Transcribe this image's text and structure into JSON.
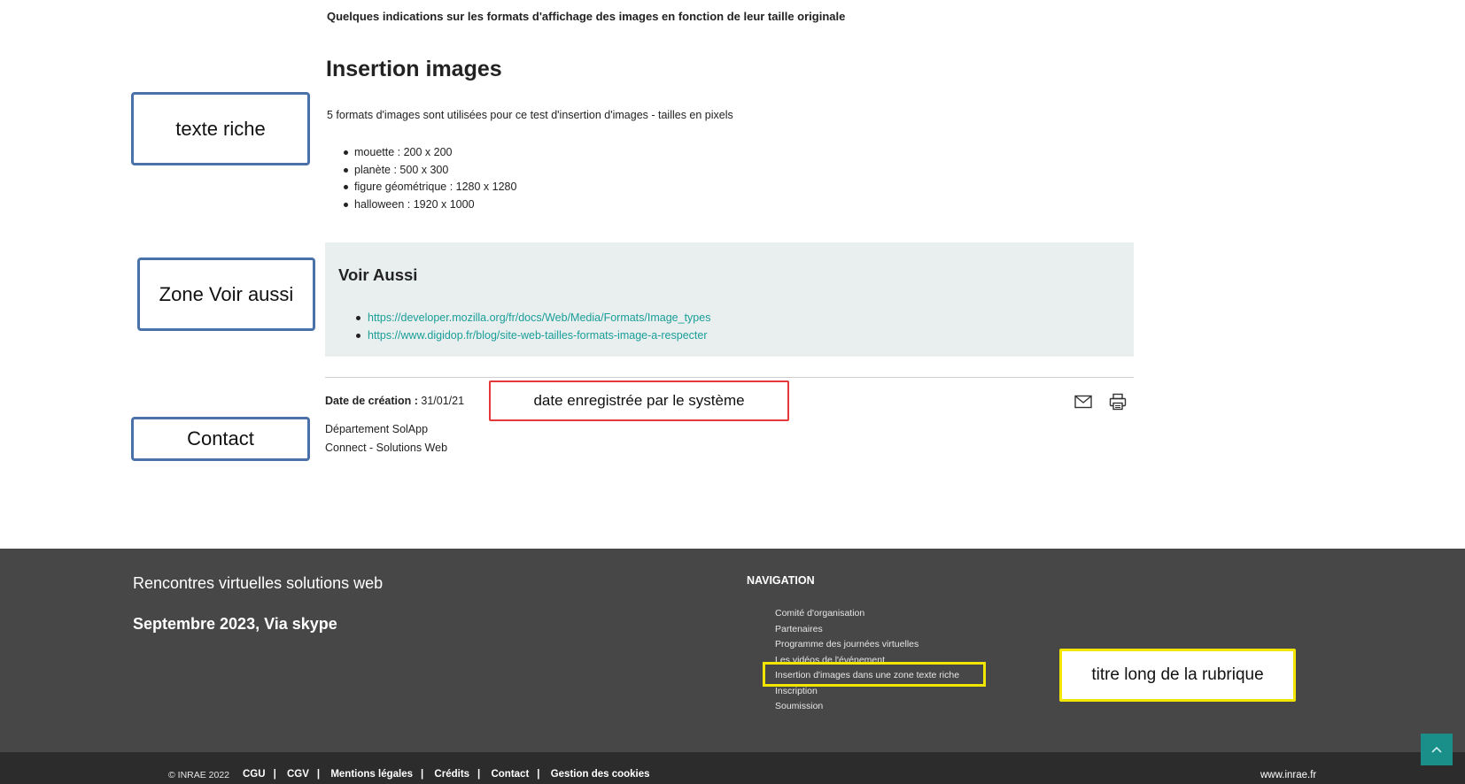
{
  "content": {
    "subtitle": "Quelques indications sur les formats d'affichage des images en fonction de leur taille originale",
    "title": "Insertion images",
    "intro": "5 formats d'images sont utilisées pour ce test d'insertion d'images - tailles en pixels",
    "formats": [
      "mouette : 200 x 200",
      "planète : 500 x 300",
      "figure géométrique : 1280 x 1280",
      "halloween : 1920 x 1000"
    ]
  },
  "voir_aussi": {
    "title": "Voir Aussi",
    "links": [
      "https://developer.mozilla.org/fr/docs/Web/Media/Formats/Image_types",
      "https://www.digidop.fr/blog/site-web-tailles-formats-image-a-respecter"
    ]
  },
  "meta": {
    "date_label": "Date de création :",
    "date_value": "31/01/21",
    "contact_line1": "Département SolApp",
    "contact_line2": "Connect - Solutions Web",
    "icons": {
      "mail": "mail-icon",
      "print": "print-icon"
    }
  },
  "annotations": {
    "texte_riche": "texte riche",
    "voir_aussi": "Zone Voir aussi",
    "contact": "Contact",
    "date": "date enregistrée par le système",
    "titre_long": "titre long de la rubrique",
    "colors": {
      "blue": "#4a72a8",
      "red": "#e53838",
      "yellow": "#f2e600"
    }
  },
  "footer": {
    "site_name": "Rencontres virtuelles solutions web",
    "site_date": "Septembre 2023, Via skype",
    "nav_title": "NAVIGATION",
    "nav_items": [
      "Comité d'organisation",
      "Partenaires",
      "Programme des journées virtuelles",
      "Les vidéos de l'événement",
      "Insertion d'images dans une zone texte riche",
      "Inscription",
      "Soumission"
    ],
    "copyright": "© INRAE 2022",
    "legal_links": [
      "CGU",
      "CGV",
      "Mentions légales",
      "Crédits",
      "Contact",
      "Gestion des cookies"
    ],
    "website": "www.inrae.fr",
    "colors": {
      "footer_bg": "#474747",
      "bottom_bar_bg": "#2c2c2c",
      "link_accent": "#1a9e98",
      "top_button": "#1a8e88"
    }
  }
}
